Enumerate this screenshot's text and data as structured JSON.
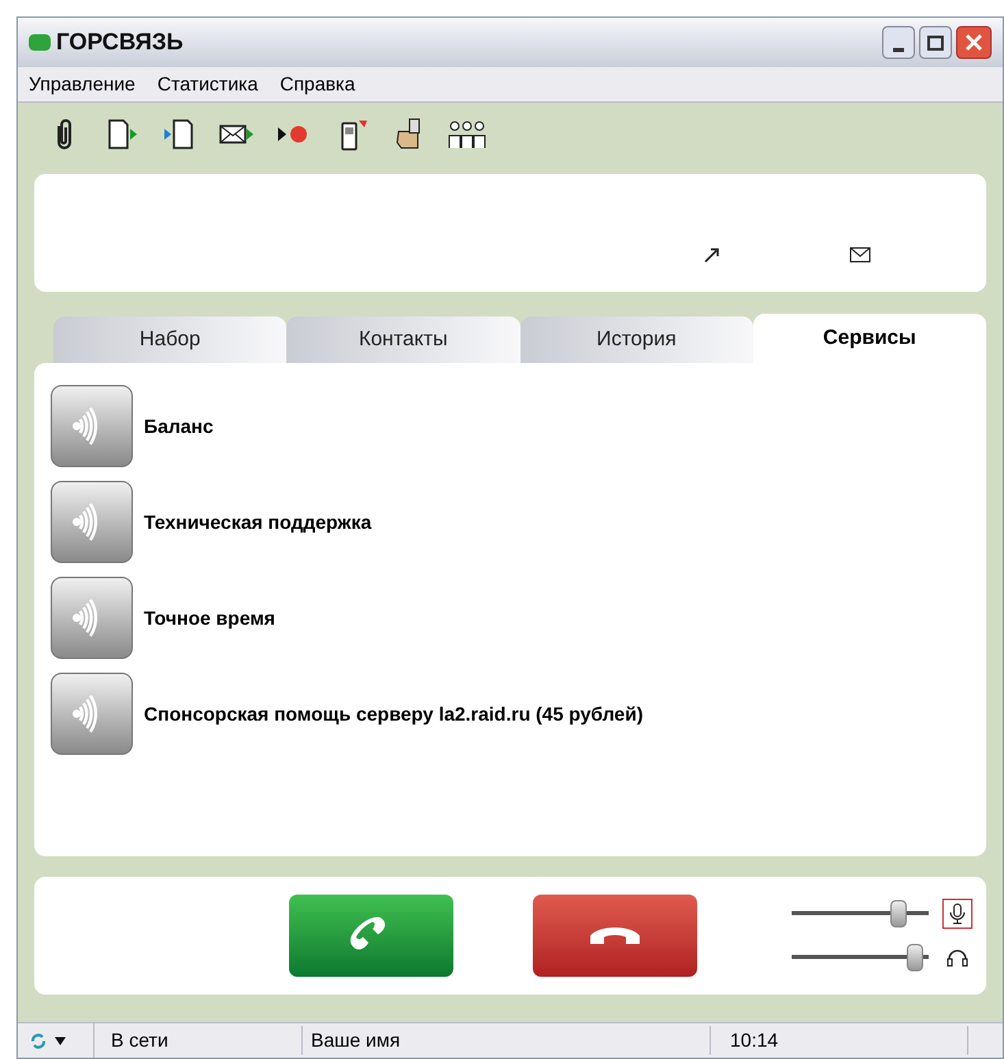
{
  "window": {
    "title": "ГОРСВЯЗЬ"
  },
  "menu": [
    "Управление",
    "Статистика",
    "Справка"
  ],
  "toolbar": [
    {
      "kind": "clip"
    },
    {
      "kind": "doc-out"
    },
    {
      "kind": "doc-in"
    },
    {
      "kind": "mail"
    },
    {
      "kind": "record"
    },
    {
      "kind": "phone"
    },
    {
      "kind": "hand"
    },
    {
      "kind": "people"
    }
  ],
  "tabs": [
    {
      "label": "Набор",
      "selected": false
    },
    {
      "label": "Контакты",
      "selected": false
    },
    {
      "label": "История",
      "selected": false
    },
    {
      "label": "Сервисы",
      "selected": true
    }
  ],
  "services": [
    "Баланс",
    "Техническая поддержка",
    "Точное время",
    "Спонсорская помощь серверу la2.raid.ru (45 рублей)"
  ],
  "volume": [
    {
      "kind": "mic",
      "level": 0.82,
      "highlighted": true
    },
    {
      "kind": "speaker",
      "level": 0.95,
      "highlighted": false
    }
  ],
  "status_bar": {
    "status": "В сети",
    "name": "Ваше имя",
    "time": "10:14"
  }
}
